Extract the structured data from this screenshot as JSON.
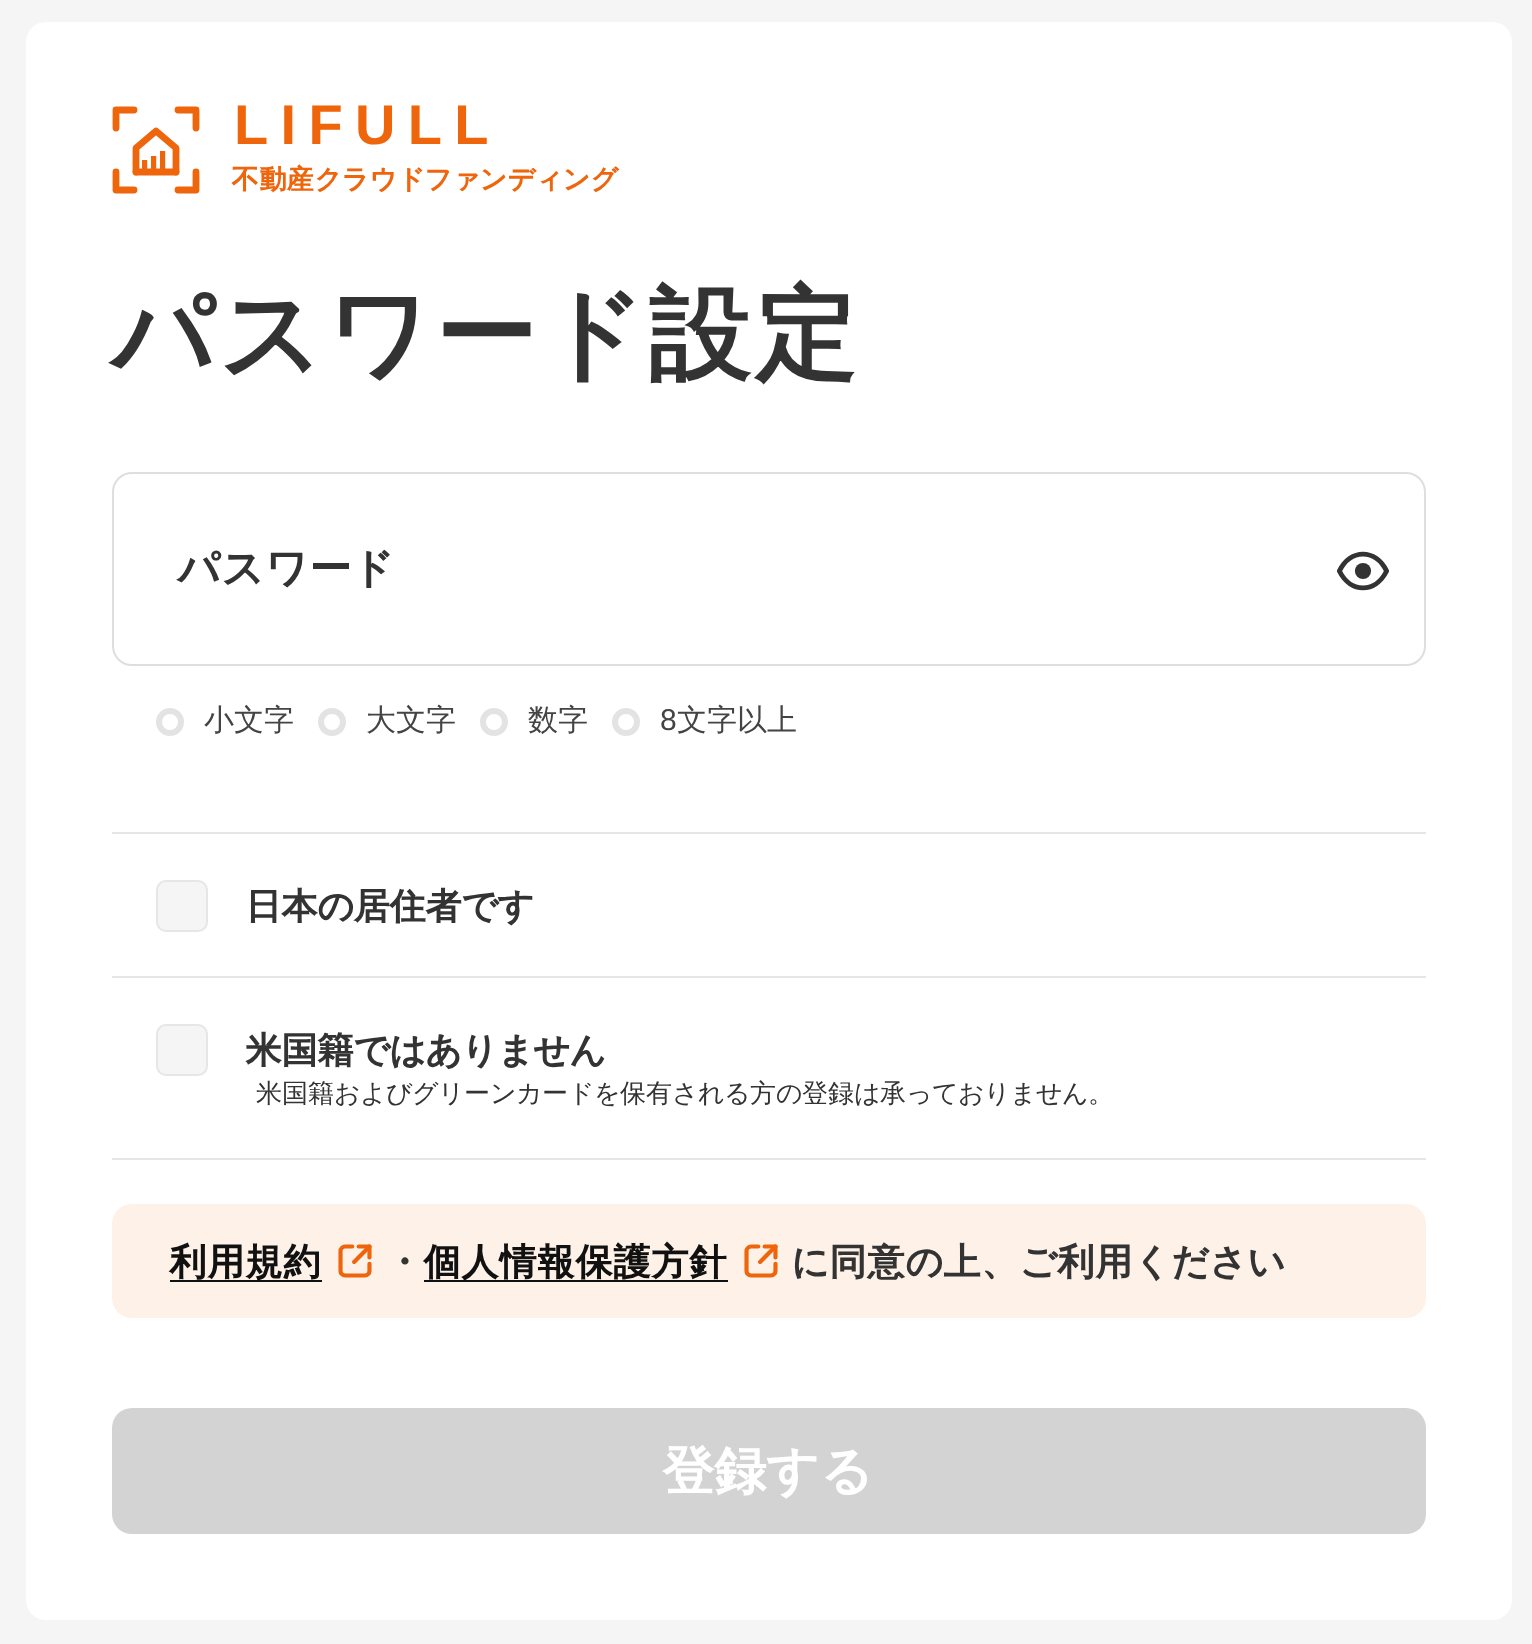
{
  "logo": {
    "wordmark": "LIFULL",
    "tagline": "不動産クラウドファンディング"
  },
  "title": "パスワード設定",
  "password_field": {
    "label": "パスワード"
  },
  "password_rules": [
    {
      "label": "小文字",
      "met": false
    },
    {
      "label": "大文字",
      "met": false
    },
    {
      "label": "数字",
      "met": false
    },
    {
      "label": "8文字以上",
      "met": false
    }
  ],
  "checkboxes": [
    {
      "label": "日本の居住者です",
      "checked": false
    },
    {
      "label": "米国籍ではありません",
      "note": "米国籍およびグリーンカードを保有される方の登録は承っておりません。",
      "checked": false
    }
  ],
  "agreement": {
    "parts": [
      {
        "kind": "link",
        "text": "利用規約"
      },
      {
        "kind": "text",
        "text": "・"
      },
      {
        "kind": "link",
        "text": "個人情報保護方針"
      },
      {
        "kind": "text",
        "text": "に同意の上、ご利用ください"
      }
    ]
  },
  "submit_button": {
    "label": "登録する",
    "disabled": true
  }
}
